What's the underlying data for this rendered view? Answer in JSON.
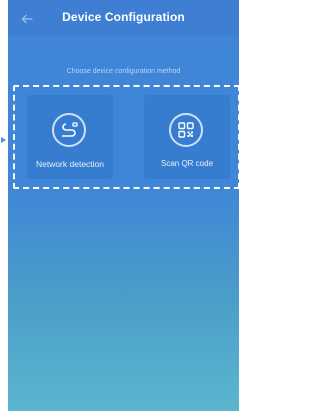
{
  "header": {
    "title": "Device Configuration",
    "back_icon": "back-arrow-icon"
  },
  "subtitle": "Choose device configuration method",
  "options": [
    {
      "label": "Network detection",
      "icon": "cable-icon"
    },
    {
      "label": "Scan QR code",
      "icon": "qr-code-icon"
    }
  ],
  "colors": {
    "header": "#3f7fd3",
    "background_top": "#3f86d8",
    "background_bottom": "#5bb6cf",
    "highlight": "#ffffff"
  }
}
